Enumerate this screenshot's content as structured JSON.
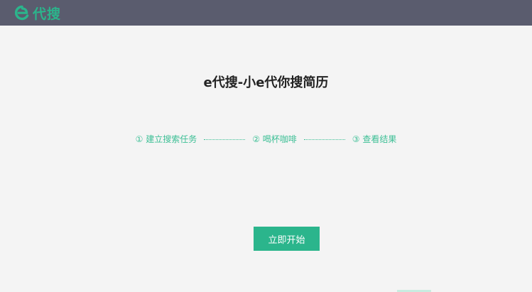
{
  "header": {
    "logo_text": "代搜",
    "logo_icon": "e-logo-icon"
  },
  "main": {
    "title": "e代搜-小e代你搜简历",
    "steps": [
      {
        "label": "① 建立搜索任务"
      },
      {
        "label": "② 喝杯咖啡"
      },
      {
        "label": "③ 查看结果"
      }
    ],
    "start_button": "立即开始"
  },
  "colors": {
    "accent": "#2bb58c",
    "header_bg": "#5a5c6e",
    "page_bg": "#f4f4f4",
    "title": "#222222"
  }
}
